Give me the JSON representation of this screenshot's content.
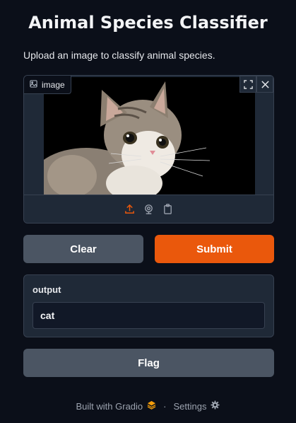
{
  "header": {
    "title": "Animal Species Classifier",
    "description": "Upload an image to classify animal species."
  },
  "image_input": {
    "label": "image",
    "sources": [
      "upload-icon",
      "webcam-icon",
      "clipboard-icon"
    ],
    "actions": [
      "fullscreen-icon",
      "close-icon"
    ]
  },
  "buttons": {
    "clear": "Clear",
    "submit": "Submit",
    "flag": "Flag"
  },
  "output": {
    "label": "output",
    "value": "cat"
  },
  "footer": {
    "built_with": "Built with Gradio",
    "separator": "·",
    "settings": "Settings"
  },
  "colors": {
    "background": "#0b0f19",
    "panel": "#1f2937",
    "accent": "#ea580c",
    "secondary_button": "#4b5563"
  }
}
